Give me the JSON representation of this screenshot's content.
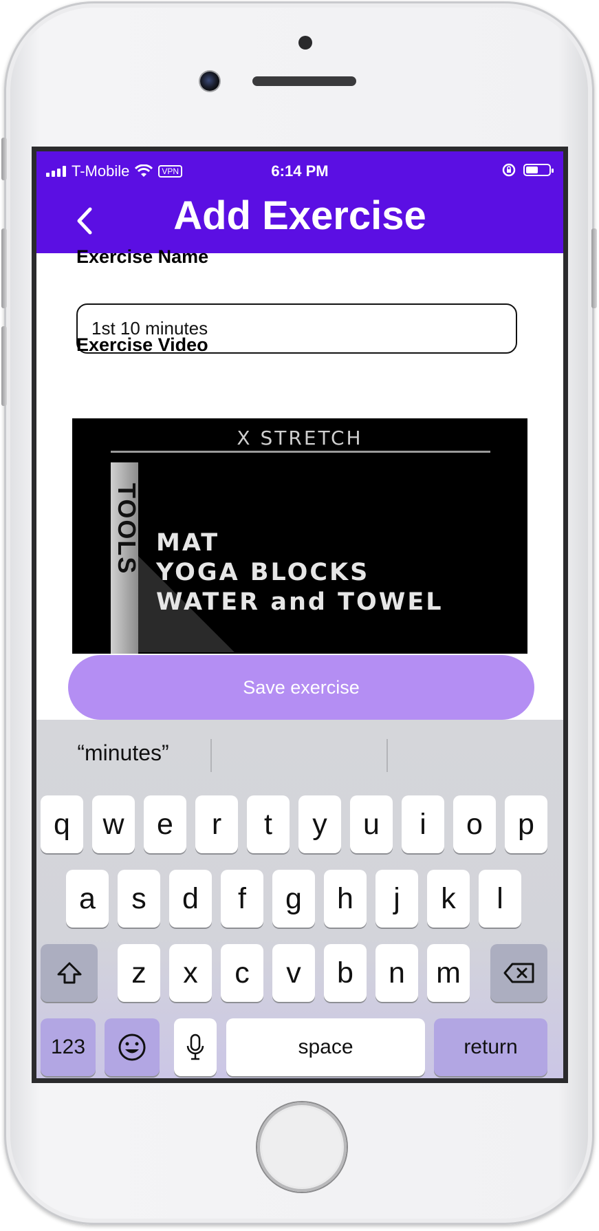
{
  "status_bar": {
    "carrier": "T-Mobile",
    "vpn": "VPN",
    "time": "6:14 PM"
  },
  "header": {
    "title": "Add Exercise",
    "accent_color": "#5b0fe3"
  },
  "form": {
    "name_label": "Exercise Name",
    "name_value": "1st 10 minutes",
    "video_label": "Exercise Video",
    "save_label": "Save exercise",
    "save_color": "#b48ef3"
  },
  "video": {
    "brand": "X STRETCH",
    "side_text": "TOOLS",
    "lines": [
      "MAT",
      "YOGA BLOCKS",
      "WATER and TOWEL"
    ]
  },
  "keyboard": {
    "suggestions": [
      "“minutes”",
      "",
      ""
    ],
    "row1": [
      "q",
      "w",
      "e",
      "r",
      "t",
      "y",
      "u",
      "i",
      "o",
      "p"
    ],
    "row2": [
      "a",
      "s",
      "d",
      "f",
      "g",
      "h",
      "j",
      "k",
      "l"
    ],
    "row3": [
      "z",
      "x",
      "c",
      "v",
      "b",
      "n",
      "m"
    ],
    "numbers_label": "123",
    "space_label": "space",
    "return_label": "return"
  }
}
